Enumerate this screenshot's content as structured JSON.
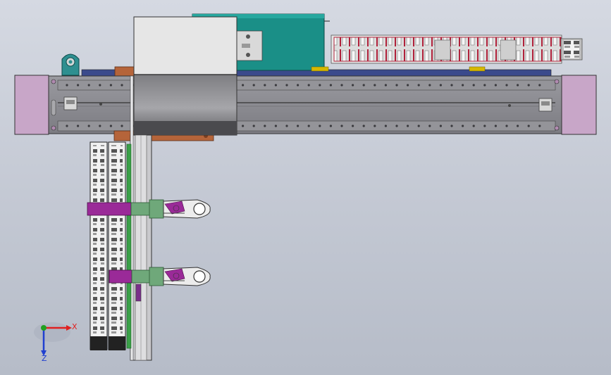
{
  "viewport": {
    "background_top": "#d5d9e2",
    "background_bottom": "#b6bcc8"
  },
  "colors": {
    "rail_body": "#8c8c90",
    "rail_dark": "#4a4a4e",
    "end_cap": "#c8a6c8",
    "carriage_top": "#e6e6e6",
    "carriage_bottom": "#808084",
    "motor_teal": "#1a8f87",
    "drag_chain_red": "#b0213a",
    "bracket_magenta": "#9a2a98",
    "adapter_green": "#6fa87a",
    "plate_orange": "#b5643a",
    "slide_green": "#3aa048",
    "plate_navy": "#3b4a8c",
    "pad_yellow": "#d6b800"
  },
  "triad": {
    "x_label": "X",
    "z_label": "Z",
    "x_color": "#e02020",
    "y_color": "#20a020",
    "z_color": "#2040d0",
    "icon": "coordinate-triad-icon"
  }
}
